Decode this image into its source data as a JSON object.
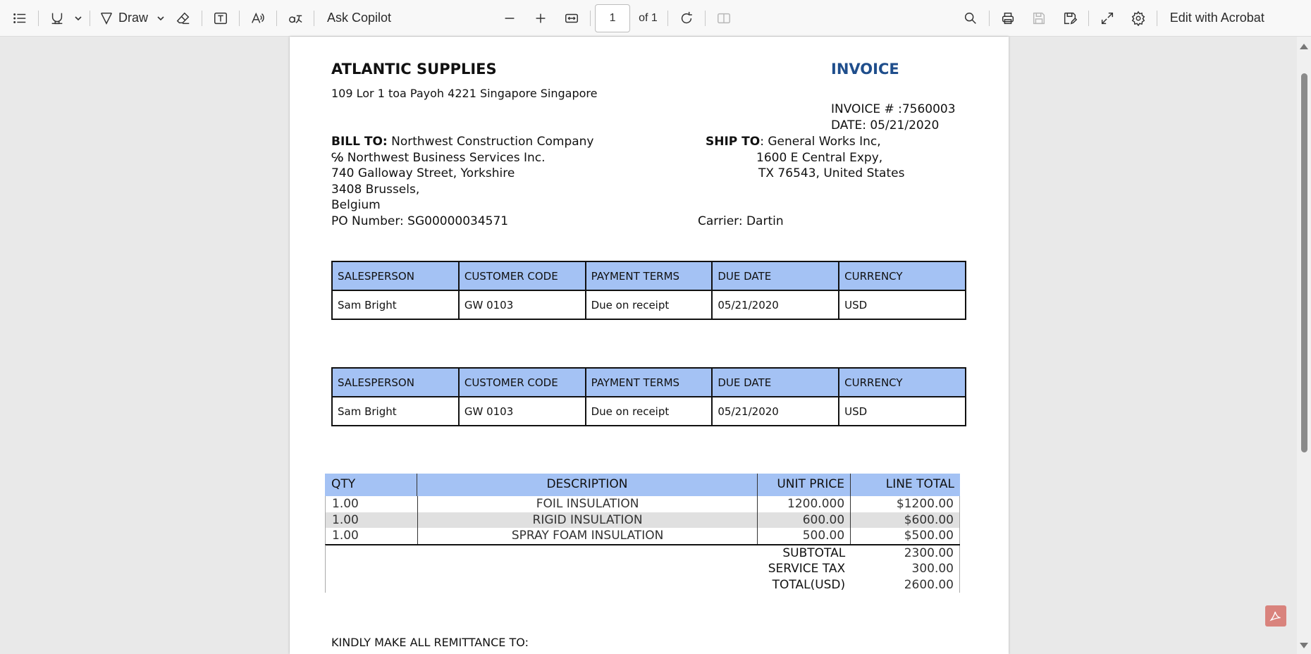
{
  "toolbar": {
    "draw_label": "Draw",
    "ask_copilot_label": "Ask Copilot",
    "page_number": "1",
    "page_total": "of 1",
    "edit_acrobat_label": "Edit with Acrobat"
  },
  "invoice": {
    "company": "ATLANTIC SUPPLIES",
    "company_address": "109 Lor 1 toa Payoh 4221 Singapore Singapore",
    "title": "INVOICE",
    "number_line": "INVOICE # :7560003",
    "date_line": "DATE: 05/21/2020",
    "bill_to_label": "BILL TO:",
    "bill_to_lines": [
      "Northwest Construction Company",
      "℅ Northwest Business Services Inc.",
      "740 Galloway Street, Yorkshire",
      "3408 Brussels,",
      "Belgium"
    ],
    "po_number": "PO Number: SG00000034571",
    "ship_to_label": "SHIP TO",
    "ship_to_lines": [
      ": General Works Inc,",
      "1600 E Central Expy,",
      "TX 76543, United States"
    ],
    "carrier": "Carrier: Dartin",
    "info_headers": [
      "SALESPERSON",
      "CUSTOMER CODE",
      "PAYMENT TERMS",
      "DUE DATE",
      "CURRENCY"
    ],
    "info_values": [
      "Sam Bright",
      "GW 0103",
      "Due on receipt",
      "05/21/2020",
      "USD"
    ],
    "item_headers": [
      "QTY",
      "DESCRIPTION",
      "UNIT PRICE",
      "LINE TOTAL"
    ],
    "items": [
      {
        "qty": "1.00",
        "description": "FOIL INSULATION",
        "unit_price": "1200.000",
        "line_total": "$1200.00"
      },
      {
        "qty": "1.00",
        "description": "RIGID INSULATION",
        "unit_price": "600.00",
        "line_total": "$600.00"
      },
      {
        "qty": "1.00",
        "description": "SPRAY FOAM INSULATION",
        "unit_price": "500.00",
        "line_total": "$500.00"
      }
    ],
    "totals": [
      {
        "label": "SUBTOTAL",
        "value": "2300.00"
      },
      {
        "label": "SERVICE TAX",
        "value": "300.00"
      },
      {
        "label": "TOTAL(USD)",
        "value": "2600.00"
      }
    ],
    "remit": "KINDLY MAKE ALL REMITTANCE TO:"
  }
}
